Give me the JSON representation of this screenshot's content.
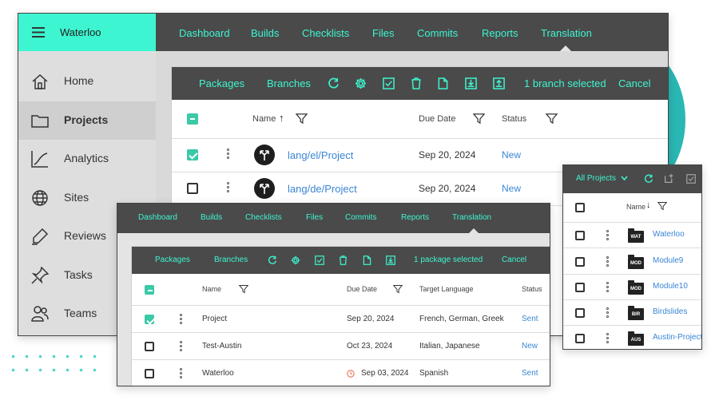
{
  "colors": {
    "accent": "#3df5d0",
    "link": "#3a86d4",
    "checkbox": "#3bc9a6",
    "header_dark": "#4a4a4a",
    "brand_bg": "#3df5d0"
  },
  "main": {
    "brand": "Waterloo",
    "topnav": [
      "Dashboard",
      "Builds",
      "Checklists",
      "Files",
      "Commits",
      "Reports",
      "Translation"
    ],
    "sidebar": [
      {
        "label": "Home",
        "icon": "home-icon"
      },
      {
        "label": "Projects",
        "icon": "folder-icon",
        "active": true
      },
      {
        "label": "Analytics",
        "icon": "analytics-icon"
      },
      {
        "label": "Sites",
        "icon": "globe-icon"
      },
      {
        "label": "Reviews",
        "icon": "pen-icon"
      },
      {
        "label": "Tasks",
        "icon": "pin-icon"
      },
      {
        "label": "Teams",
        "icon": "team-icon"
      }
    ],
    "toolbar": {
      "tabs": [
        "Packages",
        "Branches"
      ],
      "selection": "1 branch selected",
      "cancel": "Cancel"
    },
    "table": {
      "headers": {
        "name": "Name",
        "due": "Due Date",
        "status": "Status"
      },
      "rows": [
        {
          "name": "lang/el/Project",
          "due": "Sep 20, 2024",
          "status": "New",
          "checked": true
        },
        {
          "name": "lang/de/Project",
          "due": "Sep 20, 2024",
          "status": "New",
          "checked": false
        }
      ]
    }
  },
  "packages": {
    "topnav": [
      "Dashboard",
      "Builds",
      "Checklists",
      "Files",
      "Commits",
      "Reports",
      "Translation"
    ],
    "toolbar": {
      "tabs": [
        "Packages",
        "Branches"
      ],
      "selection": "1 package selected",
      "cancel": "Cancel"
    },
    "headers": {
      "name": "Name",
      "due": "Due Date",
      "target": "Target Language",
      "status": "Status"
    },
    "rows": [
      {
        "name": "Project",
        "due": "Sep 20, 2024",
        "target": "French, German, Greek",
        "status": "Sent",
        "checked": true
      },
      {
        "name": "Test-Austin",
        "due": "Oct 23, 2024",
        "target": "Italian, Japanese",
        "status": "New",
        "checked": false
      },
      {
        "name": "Waterloo",
        "due": "Sep 03, 2024",
        "target": "Spanish",
        "status": "Sent",
        "checked": false,
        "overdue": true
      }
    ]
  },
  "projects": {
    "dropdown": "All Projects",
    "header_name": "Name",
    "rows": [
      {
        "tag": "WAT",
        "name": "Waterloo"
      },
      {
        "tag": "MOD",
        "name": "Module9"
      },
      {
        "tag": "MOD",
        "name": "Module10"
      },
      {
        "tag": "BIR",
        "name": "Birdslides"
      },
      {
        "tag": "AUS",
        "name": "Austin-Project"
      }
    ]
  }
}
